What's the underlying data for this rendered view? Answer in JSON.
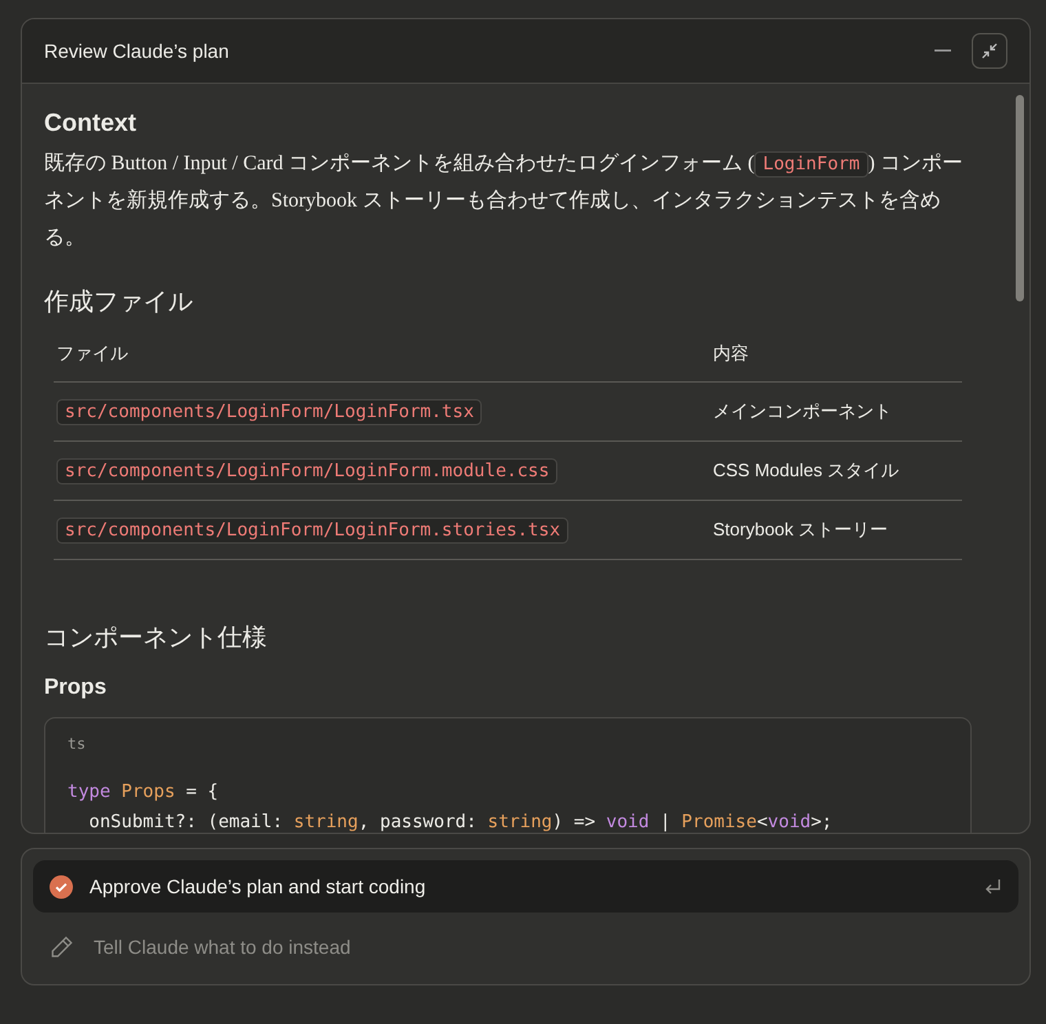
{
  "window": {
    "title": "Review Claude’s plan"
  },
  "plan": {
    "context": {
      "heading": "Context",
      "paragraph": [
        {
          "kind": "text",
          "text": "既存の Button / Input / Card コンポーネントを組み合わせたログインフォーム ("
        },
        {
          "kind": "code",
          "text": "LoginForm"
        },
        {
          "kind": "text",
          "text": ") コンポーネントを新規作成する。Storybook ストーリーも合わせて作成し、インタラクションテストを含める。"
        }
      ]
    },
    "files": {
      "heading": "作成ファイル",
      "columns": [
        "ファイル",
        "内容"
      ],
      "rows": [
        {
          "file": "src/components/LoginForm/LoginForm.tsx",
          "content": "メインコンポーネント"
        },
        {
          "file": "src/components/LoginForm/LoginForm.module.css",
          "content": "CSS Modules スタイル"
        },
        {
          "file": "src/components/LoginForm/LoginForm.stories.tsx",
          "content": "Storybook ストーリー"
        }
      ]
    },
    "spec": {
      "heading": "コンポーネント仕様",
      "subheading": "Props",
      "code": {
        "language": "ts",
        "lines": [
          [
            {
              "kind": "keyword",
              "text": "type "
            },
            {
              "kind": "type",
              "text": "Props"
            },
            {
              "kind": "plain",
              "text": " = {"
            }
          ],
          [
            {
              "kind": "plain",
              "text": "  onSubmit?: (email: "
            },
            {
              "kind": "type",
              "text": "string"
            },
            {
              "kind": "plain",
              "text": ", password: "
            },
            {
              "kind": "type",
              "text": "string"
            },
            {
              "kind": "plain",
              "text": ") => "
            },
            {
              "kind": "keyword",
              "text": "void"
            },
            {
              "kind": "plain",
              "text": " | "
            },
            {
              "kind": "type",
              "text": "Promise"
            },
            {
              "kind": "plain",
              "text": "<"
            },
            {
              "kind": "keyword",
              "text": "void"
            },
            {
              "kind": "plain",
              "text": ">;"
            }
          ]
        ]
      }
    }
  },
  "options": [
    {
      "kind": "approve",
      "label": "Approve Claude’s plan and start coding",
      "selected": true
    },
    {
      "kind": "instruct",
      "placeholder": "Tell Claude what to do instead",
      "selected": false
    }
  ]
}
